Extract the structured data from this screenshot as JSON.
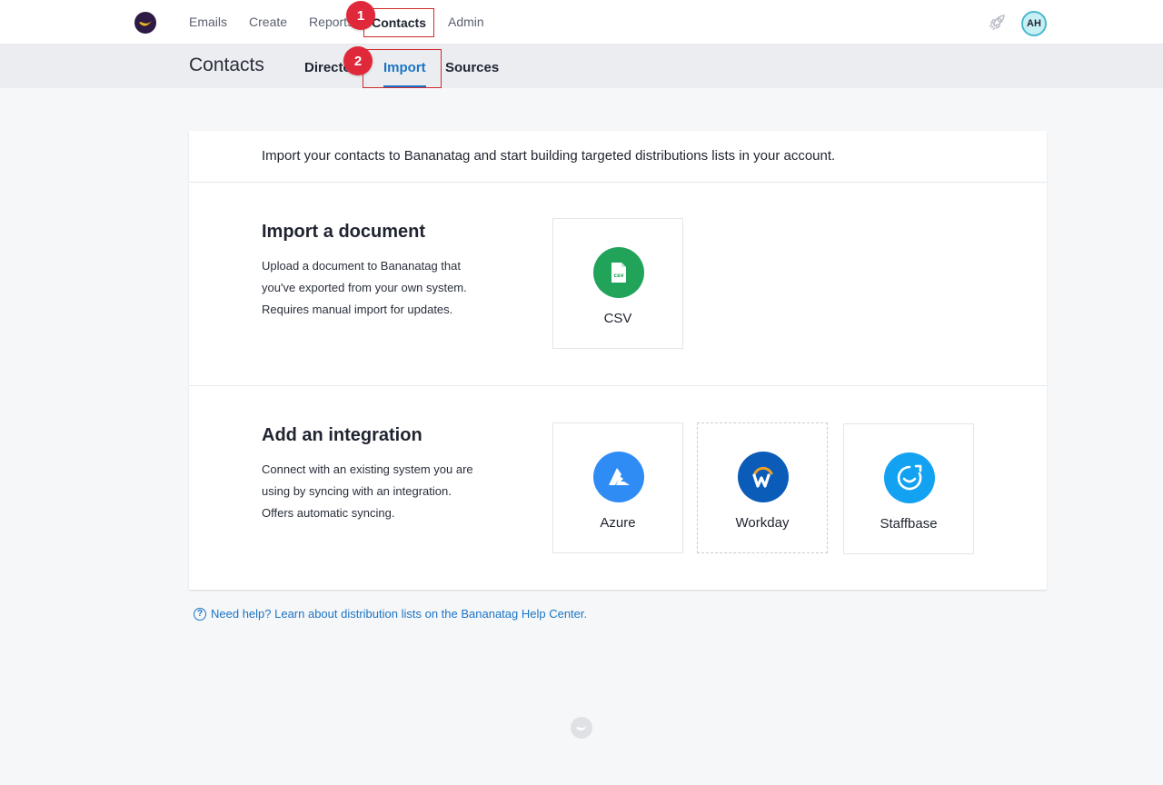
{
  "topnav": {
    "items": [
      {
        "label": "Emails"
      },
      {
        "label": "Create"
      },
      {
        "label": "Reports"
      },
      {
        "label": "Contacts"
      },
      {
        "label": "Admin"
      }
    ],
    "avatar": "AH"
  },
  "subnav": {
    "title": "Contacts",
    "tabs": [
      {
        "label": "Directory"
      },
      {
        "label": "Import"
      },
      {
        "label": "Sources"
      }
    ]
  },
  "annotations": [
    "1",
    "2"
  ],
  "intro": "Import your contacts to Bananatag and start building targeted distributions lists in your account.",
  "import_section": {
    "title": "Import a document",
    "description": "Upload a document to Bananatag that you've exported from your own system. Requires manual import for updates.",
    "tiles": [
      {
        "label": "CSV",
        "icon": "csv-file-icon",
        "color": "#21a35a",
        "badge": "csv"
      }
    ]
  },
  "integration_section": {
    "title": "Add an integration",
    "description": "Connect with an existing system you are using by syncing with an integration. Offers automatic syncing.",
    "tiles": [
      {
        "label": "Azure",
        "icon": "azure-icon",
        "color": "#2f8cf5"
      },
      {
        "label": "Workday",
        "icon": "workday-icon",
        "color": "#0a5cb8"
      },
      {
        "label": "Staffbase",
        "icon": "staffbase-icon",
        "color": "#13a2f2"
      }
    ]
  },
  "help": {
    "text": "Need help? Learn about distribution lists on the Bananatag Help Center."
  }
}
